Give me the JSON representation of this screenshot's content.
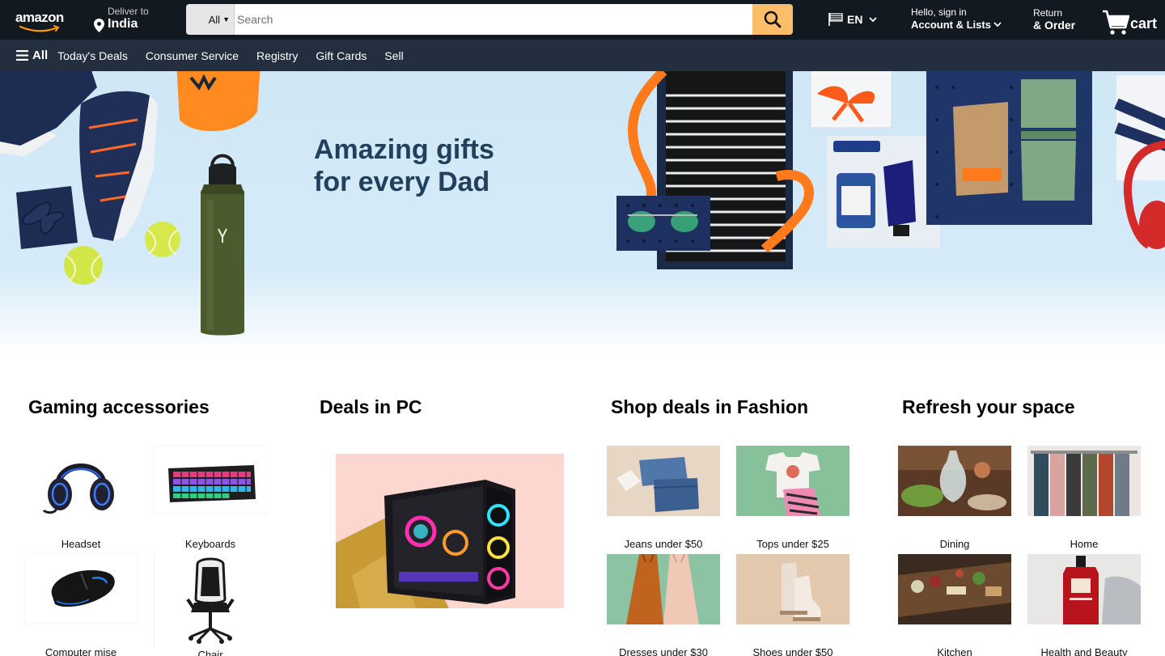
{
  "header": {
    "logo_text": "amazon",
    "deliver_label": "Deliver to",
    "deliver_location": "India",
    "search_category": "All",
    "search_placeholder": "Search",
    "language_code": "EN",
    "account_greeting": "Hello, sign in",
    "account_lists": "Account & Lists",
    "returns_line1": "Return",
    "returns_line2": "& Order",
    "cart_label": "cart"
  },
  "subnav": {
    "all_label": "All",
    "items": [
      "Today's Deals",
      "Consumer Service",
      "Registry",
      "Gift Cards",
      "Sell"
    ]
  },
  "hero": {
    "title_line1": "Amazing gifts",
    "title_line2": "for every Dad"
  },
  "cards": [
    {
      "title": "Gaming accessories",
      "tiles": [
        {
          "label": "Headset",
          "icon": "headset-image"
        },
        {
          "label": "Keyboards",
          "icon": "keyboard-image"
        },
        {
          "label": "Computer mise",
          "icon": "mouse-image"
        },
        {
          "label": "Chair",
          "icon": "gaming-chair-image"
        }
      ]
    },
    {
      "title": "Deals in PC",
      "image": "gaming-pc-image"
    },
    {
      "title": "Shop deals in Fashion",
      "tiles": [
        {
          "label": "Jeans under $50",
          "icon": "jeans-image"
        },
        {
          "label": "Tops under $25",
          "icon": "tops-image"
        },
        {
          "label": "Dresses under $30",
          "icon": "dresses-image"
        },
        {
          "label": "Shoes under $50",
          "icon": "shoes-image"
        }
      ]
    },
    {
      "title": "Refresh your space",
      "tiles": [
        {
          "label": "Dining",
          "icon": "dining-image"
        },
        {
          "label": "Home",
          "icon": "home-image"
        },
        {
          "label": "Kitchen",
          "icon": "kitchen-image"
        },
        {
          "label": "Health and Beauty",
          "icon": "health-beauty-image"
        }
      ]
    }
  ],
  "colors": {
    "nav_dark": "#131921",
    "nav_secondary": "#232f3e",
    "search_button": "#febd69",
    "hero_sky": "#cfe7f6",
    "hero_text": "#22405b"
  }
}
